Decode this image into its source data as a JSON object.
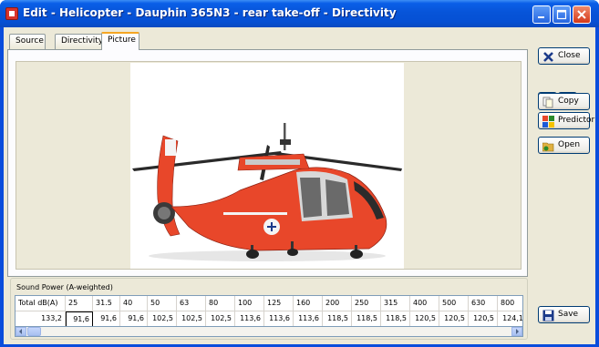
{
  "window": {
    "title": "Edit - Helicopter - Dauphin 365N3 - rear take-off - Directivity"
  },
  "tabs": [
    {
      "label": "Source"
    },
    {
      "label": "Directivity"
    },
    {
      "label": "Picture"
    }
  ],
  "active_tab": "Picture",
  "sidebar": {
    "close": "Close",
    "copy": "Copy",
    "predictor": "Predictor",
    "open": "Open",
    "save": "Save"
  },
  "sound_power": {
    "legend": "Sound Power (A-weighted)",
    "headers": [
      "Total dB(A)",
      "25",
      "31.5",
      "40",
      "50",
      "63",
      "80",
      "100",
      "125",
      "160",
      "200",
      "250",
      "315",
      "400",
      "500",
      "630",
      "800"
    ],
    "values": [
      "133,2",
      "91,6",
      "91,6",
      "91,6",
      "102,5",
      "102,5",
      "102,5",
      "113,6",
      "113,6",
      "113,6",
      "118,5",
      "118,5",
      "118,5",
      "120,5",
      "120,5",
      "120,5",
      "124,1"
    ]
  },
  "colors": {
    "titlebar": "#0754d8",
    "client": "#ece9d8",
    "helicopter_body": "#e8472a",
    "close_button": "#d4391a"
  },
  "icons": {
    "close": "x-icon",
    "prev": "double-left-arrow-icon",
    "next": "double-right-arrow-icon",
    "copy": "copy-icon",
    "predictor": "predictor-icon",
    "open": "open-folder-icon",
    "save": "floppy-disk-icon"
  }
}
